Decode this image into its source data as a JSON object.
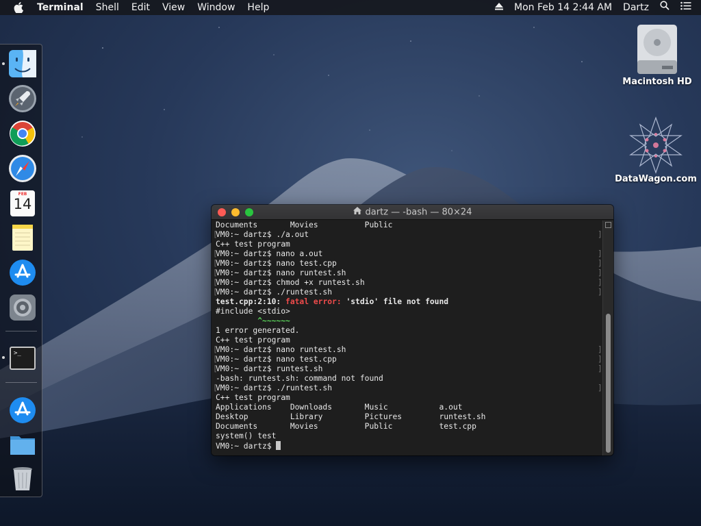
{
  "menubar": {
    "app": "Terminal",
    "items": [
      "Shell",
      "Edit",
      "View",
      "Window",
      "Help"
    ],
    "datetime": "Mon Feb 14  2:44 AM",
    "user": "Dartz"
  },
  "dock": {
    "apps": [
      "finder-icon",
      "launchpad-icon",
      "chrome-icon",
      "safari-icon",
      "calendar-icon",
      "notes-icon",
      "app-store-icon",
      "system-preferences-icon",
      "terminal-icon",
      "app-store-downloads-icon",
      "folder-icon",
      "trash-icon"
    ],
    "calendar_month": "FEB",
    "calendar_day": "14",
    "terminal_prompt": ">_"
  },
  "desktop": {
    "icons": [
      {
        "label": "Macintosh HD",
        "icon": "hard-drive-icon"
      },
      {
        "label": "DataWagon.com",
        "icon": "datawagon-icon"
      }
    ]
  },
  "terminal": {
    "title": "dartz — -bash — 80×24",
    "lines": [
      "Documents       Movies          Public",
      "VM0:~ dartz$ ./a.out",
      "C++ test program",
      "VM0:~ dartz$ nano a.out",
      "VM0:~ dartz$ nano test.cpp",
      "VM0:~ dartz$ nano runtest.sh",
      "VM0:~ dartz$ chmod +x runtest.sh",
      "VM0:~ dartz$ ./runtest.sh",
      "",
      "#include <stdio>",
      "         ^~~~~~~",
      "1 error generated.",
      "C++ test program",
      "VM0:~ dartz$ nano runtest.sh",
      "VM0:~ dartz$ nano test.cpp",
      "VM0:~ dartz$ runtest.sh",
      "-bash: runtest.sh: command not found",
      "VM0:~ dartz$ ./runtest.sh",
      "C++ test program",
      "Applications    Downloads       Music           a.out",
      "Desktop         Library         Pictures        runtest.sh",
      "Documents       Movies          Public          test.cpp",
      "system() test",
      "VM0:~ dartz$ "
    ],
    "error_line": {
      "prefix": "test.cpp:2:10: ",
      "label": "fatal error:",
      "message": " 'stdio' file not found"
    },
    "colors": {
      "error": "#ee4b4b",
      "caret": "#5ad45a",
      "background": "#1e1e1e"
    }
  }
}
